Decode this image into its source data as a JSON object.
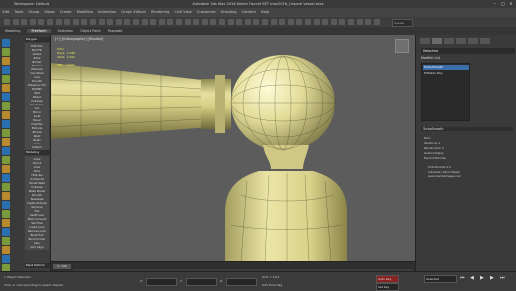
{
  "window": {
    "title": "Autodesk 3ds Max 2016   Kohler Faucet SET max2016_Casone Vessel.max",
    "workspace": "Workspace: Default"
  },
  "menu": [
    "Edit",
    "Tools",
    "Group",
    "Views",
    "Create",
    "Modifiers",
    "Animation",
    "Graph Editors",
    "Rendering",
    "Civil View",
    "Customize",
    "Scripting",
    "Content",
    "Help"
  ],
  "toolbar": {
    "view_select": "View",
    "selection_set": "Create Selection Se"
  },
  "ribbon": {
    "tabs": [
      "Modeling",
      "Freeform",
      "Selection",
      "Object Paint",
      "Populate"
    ],
    "active": "Freeform"
  },
  "modeling_panel": {
    "title": "Polygon Modeling",
    "items": [
      "Edit Poly",
      "Mod Fill",
      "Vertex",
      "Edge",
      "Border",
      "Polygon",
      "Element",
      "Use Stack",
      "Axis",
      "Smooth",
      "Preserve UVs",
      "NURMS",
      "Hard",
      "Attach",
      "Collapse",
      "Quickslice",
      "Cut",
      "Mirror",
      "Inset",
      "Bevel",
      "Chamfer",
      "Extrude",
      "Bridge",
      "Weld",
      "Relax",
      "Cap",
      "Detach"
    ],
    "section2_title": "Modeling",
    "items2": [
      "Grow",
      "Shrink",
      "Loop",
      "Ring",
      "Hide Sel",
      "Unhide All",
      "Target Weld",
      "Collapse",
      "Make Planar",
      "Smooth",
      "Tessellate",
      "Create Polygon",
      "Remove",
      "Flip",
      "Swift Loop",
      "Paint Connect",
      "Set Flow",
      "Insert Loop",
      "Remove Loop",
      "Build End",
      "Build Corner",
      "Spin",
      "Grid Align"
    ],
    "footer": "Paint Deform"
  },
  "viewport": {
    "label": "[+] [Orthographic] [Shaded]",
    "stats": [
      "Total",
      "Polys:  2,196",
      "Verts:  2,192",
      "",
      "FPS:    0.000"
    ]
  },
  "right_panel": {
    "object_name": "Detached",
    "modifier_list_label": "Modifier List",
    "stack": [
      "TurboSmooth",
      "Editable Poly"
    ],
    "selected_index": 0,
    "section_label": "TurboSmooth",
    "params": [
      "Main",
      "Iterations: 1",
      "Render Iters: 0",
      "Isoline Display",
      "Explicit Normals"
    ],
    "author_block": [
      "TurboSmooth  2.0",
      "Autodesk / Paolo Maglio",
      "www.mentalimages.com"
    ]
  },
  "timeline": {
    "frame": "0 / 100"
  },
  "status": {
    "left_text": "1 Object Selected",
    "hint": "Click or click-and-drag to select objects",
    "x_label": "X:",
    "y_label": "Y:",
    "z_label": "Z:",
    "grid_text": "Grid = 10.0",
    "autokey": "Auto Key",
    "setkey": "Set Key",
    "key_filter": "Selected",
    "add_time_tag": "Add Time Tag"
  }
}
